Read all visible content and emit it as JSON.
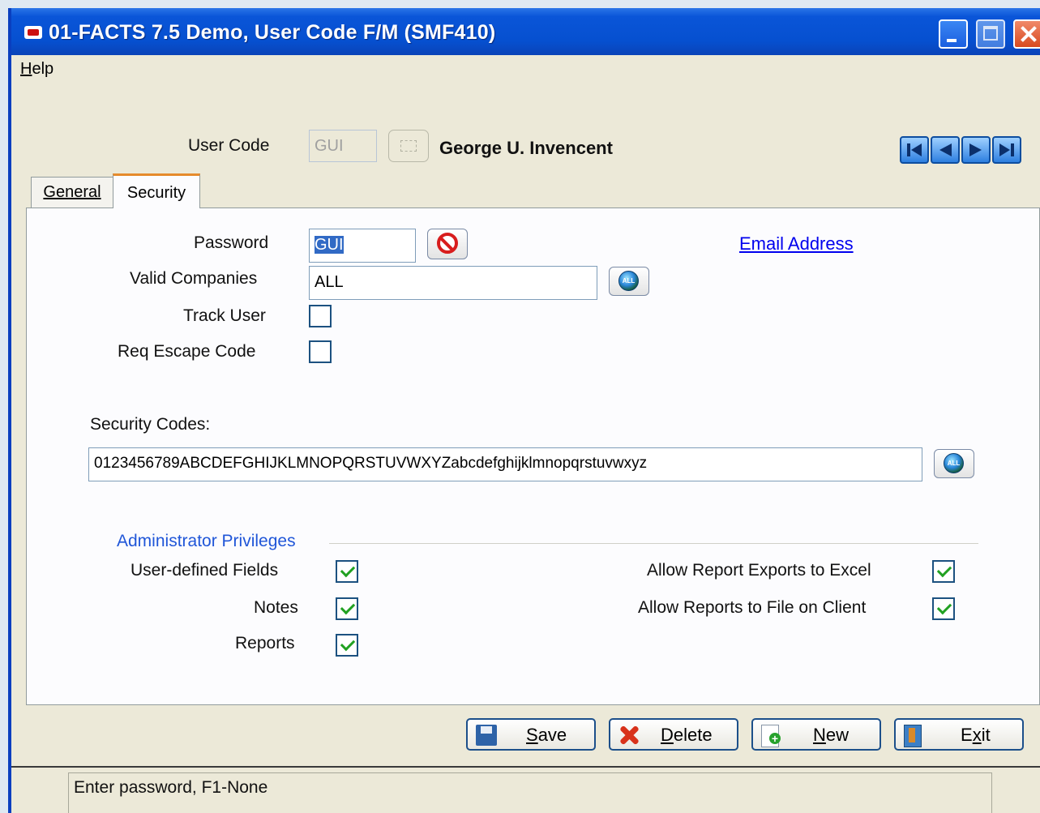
{
  "window": {
    "title": "01-FACTS 7.5 Demo, User Code F/M (SMF410)"
  },
  "menu": {
    "help": "Help"
  },
  "header": {
    "user_code_label": "User Code",
    "user_code_value": "GUI",
    "user_name": "George U. Invencent"
  },
  "tabs": [
    {
      "label": "General",
      "active": false
    },
    {
      "label": "Security",
      "active": true
    }
  ],
  "security": {
    "password_label": "Password",
    "password_value": "GUI",
    "email_link": "Email Address",
    "valid_companies_label": "Valid Companies",
    "valid_companies_value": "ALL",
    "track_user_label": "Track User",
    "track_user_checked": false,
    "req_escape_label": "Req Escape Code",
    "req_escape_checked": false,
    "security_codes_label": "Security Codes:",
    "security_codes_value": "0123456789ABCDEFGHIJKLMNOPQRSTUVWXYZabcdefghijklmnopqrstuvwxyz",
    "all_button_text": "ALL"
  },
  "admin": {
    "title": "Administrator Privileges",
    "items": [
      {
        "label": "User-defined Fields",
        "checked": true
      },
      {
        "label": "Notes",
        "checked": true
      },
      {
        "label": "Reports",
        "checked": true
      },
      {
        "label": "Allow Report Exports to Excel",
        "checked": true
      },
      {
        "label": "Allow Reports to File on Client",
        "checked": true
      }
    ]
  },
  "actions": {
    "save": "Save",
    "delete": "Delete",
    "new": "New",
    "exit": "Exit"
  },
  "status": {
    "text": "Enter password, F1-None"
  },
  "colors": {
    "titlebar": "#0650d0",
    "link": "#0000ee",
    "group_title": "#2056d8",
    "active_tab_accent": "#e68b2c"
  }
}
